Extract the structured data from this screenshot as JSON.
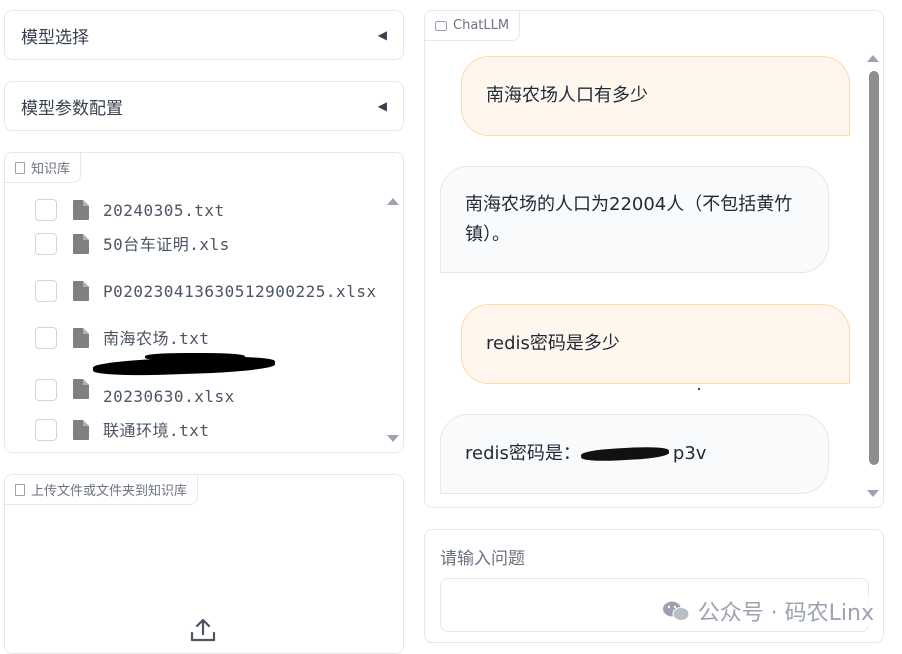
{
  "left": {
    "model_select": {
      "title": "模型选择"
    },
    "model_params": {
      "title": "模型参数配置"
    },
    "knowledge_base": {
      "label": "知识库",
      "files": [
        {
          "name": "20240305.txt"
        },
        {
          "name": "50台车证明.xls"
        },
        {
          "name": "P020230413630512900225.xlsx"
        },
        {
          "name": "南海农场.txt"
        },
        {
          "name": "20230630.xlsx"
        },
        {
          "name": "联通环境.txt"
        }
      ]
    },
    "upload": {
      "label": "上传文件或文件夹到知识库"
    }
  },
  "chat": {
    "label": "ChatLLM",
    "messages": [
      {
        "role": "user",
        "text": "南海农场人口有多少"
      },
      {
        "role": "bot",
        "text": "南海农场的人口为22004人（不包括黄竹镇）。"
      },
      {
        "role": "user",
        "text": "redis密码是多少"
      },
      {
        "role": "bot",
        "text": "redis密码是：",
        "suffix": "p3v"
      }
    ]
  },
  "input": {
    "label": "请输入问题",
    "value": ""
  },
  "watermark": {
    "text": "公众号 · 码农Linx"
  }
}
